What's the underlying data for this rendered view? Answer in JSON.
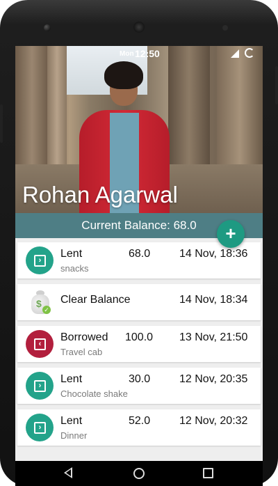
{
  "status_bar": {
    "day": "Mon",
    "time": "12:50"
  },
  "header": {
    "user_name": "Rohan Agarwal"
  },
  "balance": {
    "label": "Current Balance: 68.0"
  },
  "fab": {
    "label": "+"
  },
  "transactions": [
    {
      "type": "Lent",
      "amount": "68.0",
      "date": "14 Nov, 18:36",
      "note": "snacks",
      "icon": "lent-arrow-icon"
    },
    {
      "type": "Clear Balance",
      "amount": "",
      "date": "14 Nov, 18:34",
      "note": "",
      "icon": "money-bag-icon"
    },
    {
      "type": "Borrowed",
      "amount": "100.0",
      "date": "13 Nov, 21:50",
      "note": "Travel cab",
      "icon": "borrowed-arrow-icon"
    },
    {
      "type": "Lent",
      "amount": "30.0",
      "date": "12 Nov, 20:35",
      "note": "Chocolate shake",
      "icon": "lent-arrow-icon"
    },
    {
      "type": "Lent",
      "amount": "52.0",
      "date": "12 Nov, 20:32",
      "note": "Dinner",
      "icon": "lent-arrow-icon"
    }
  ],
  "colors": {
    "balance_bar": "#4e7e85",
    "fab": "#1e9a82",
    "lent_icon": "#23a38a",
    "borrowed_icon": "#b21f3d"
  }
}
